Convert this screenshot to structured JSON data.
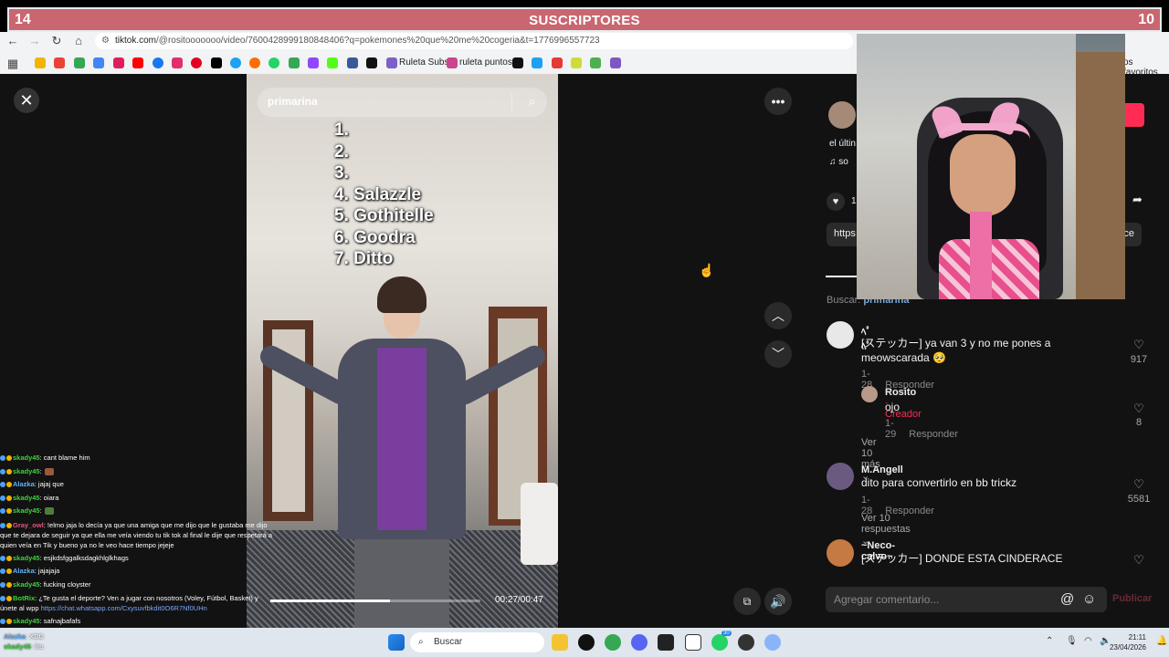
{
  "banner": {
    "left": "14",
    "title": "SUSCRIPTORES",
    "right": "10"
  },
  "browser": {
    "url_domain": "tiktok.com",
    "url_path": "/@rositooooooo/video/7600428999180848406?q=pokemones%20que%20me%20cogeria&t=1776996557723",
    "bookmarks": [
      {
        "label": "Ruleta Subs",
        "color": "#7b61c9"
      },
      {
        "label": "ruleta puntos",
        "color": "#c9468f"
      }
    ],
    "other_bookmarks": "os favoritos"
  },
  "video": {
    "search_query": "primarina",
    "list": [
      "1.",
      "2.",
      "3.",
      "4. Salazzle",
      "5. Gothitelle",
      "6. Goodra",
      "7. Ditto"
    ],
    "time": "00:27/00:47",
    "progress": 0.57
  },
  "chat": [
    {
      "user": "skady45",
      "msg": ": cant blame him",
      "color": "#3fd13f"
    },
    {
      "user": "skady45",
      "msg": ":",
      "color": "#3fd13f",
      "emote": "#9a5a3a"
    },
    {
      "user": "Alazka",
      "msg": ": jajaj que",
      "color": "#5fb4ff"
    },
    {
      "user": "skady45",
      "msg": ": oiara",
      "color": "#3fd13f"
    },
    {
      "user": "skady45",
      "msg": ":",
      "color": "#3fd13f",
      "emote": "#4f7d3a"
    },
    {
      "user": "Gray_owl",
      "msg": ": !elmo jaja lo decía ya que una amiga que me dijo que le gustaba me dijo que te dejara de seguir ya que ella me veía viendo tu tik tok al final le dije que respetará a quien veía en Tik y bueno ya no le veo hace tiempo jejeje",
      "color": "#e0577f",
      "wrap": true
    },
    {
      "user": "skady45",
      "msg": ": esjkdsfggalksdagkhlglkhags",
      "color": "#3fd13f"
    },
    {
      "user": "Alazka",
      "msg": ": jajajaja",
      "color": "#5fb4ff"
    },
    {
      "user": "skady45",
      "msg": ": fucking cloyster",
      "color": "#3fd13f"
    },
    {
      "user": "BotRix",
      "msg": ": ¿Te gusta el deporte? Ven a jugar con nosotros (Voley, Fútbol, Basket) y únete al wpp ",
      "link": "https://chat.whatsapp.com/Cxysuvfbkdit0O6R7Nf0UHn",
      "color": "#3fd13f",
      "wrap": true
    },
    {
      "user": "skady45",
      "msg": ": safnajbafafs",
      "color": "#3fd13f"
    }
  ],
  "taskbar_chat": [
    {
      "user": "Alazka",
      "msg": ": XDD"
    },
    {
      "user": "skady45",
      "msg": ": lito"
    }
  ],
  "right_panel": {
    "desc": "el últin",
    "sound": "so",
    "likes": "1",
    "link": "https",
    "link_end": "ce",
    "search_label": "Buscar:",
    "search_query": "primarina",
    "comments": [
      {
        "name": "ﾍﾟﾍﾟ",
        "text": "[ステッカー] ya van 3 y no me pones a meowscarada 🥺",
        "date": "1-28",
        "reply": "Responder",
        "likes": "917",
        "avatar": "#e8e8e8"
      },
      {
        "name": "Rosito",
        "creator": "· Creador",
        "text": "ojo",
        "date": "1-29",
        "reply": "Responder",
        "likes": "8",
        "avatar": "#b89a88"
      },
      {
        "more": "Ver 10 más"
      },
      {
        "name": "M.Angell",
        "text": "dito para convertirlo en bb trickz",
        "date": "1-28",
        "reply": "Responder",
        "likes": "5581",
        "avatar": "#6b5a80"
      },
      {
        "more": "Ver 10 respuestas"
      },
      {
        "name": "~Neco-calvo~",
        "text": "[ステッカー] DONDE ESTA CINDERACE",
        "avatar": "#c47a40"
      }
    ],
    "input_placeholder": "Agregar comentario...",
    "publish": "Publicar"
  },
  "taskbar": {
    "search": "Buscar",
    "time": "21:11",
    "date": "23/04/2026",
    "badge_whatsapp": "30"
  }
}
